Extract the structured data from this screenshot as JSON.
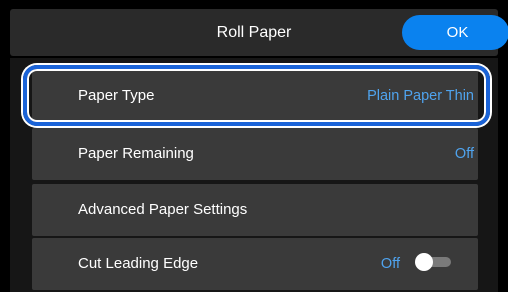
{
  "header": {
    "title": "Roll Paper",
    "ok_label": "OK"
  },
  "items": [
    {
      "label": "Paper Type",
      "value": "Plain Paper Thin",
      "selected": true
    },
    {
      "label": "Paper Remaining",
      "value": "Off"
    },
    {
      "label": "Advanced Paper Settings",
      "value": ""
    },
    {
      "label": "Cut Leading Edge",
      "value": "Off",
      "toggle_on": false
    }
  ],
  "colors": {
    "accent": "#0a82ef",
    "value_text": "#4fa3ee",
    "highlight_border": "#1a63d8",
    "row_background": "#3a3a3a"
  }
}
